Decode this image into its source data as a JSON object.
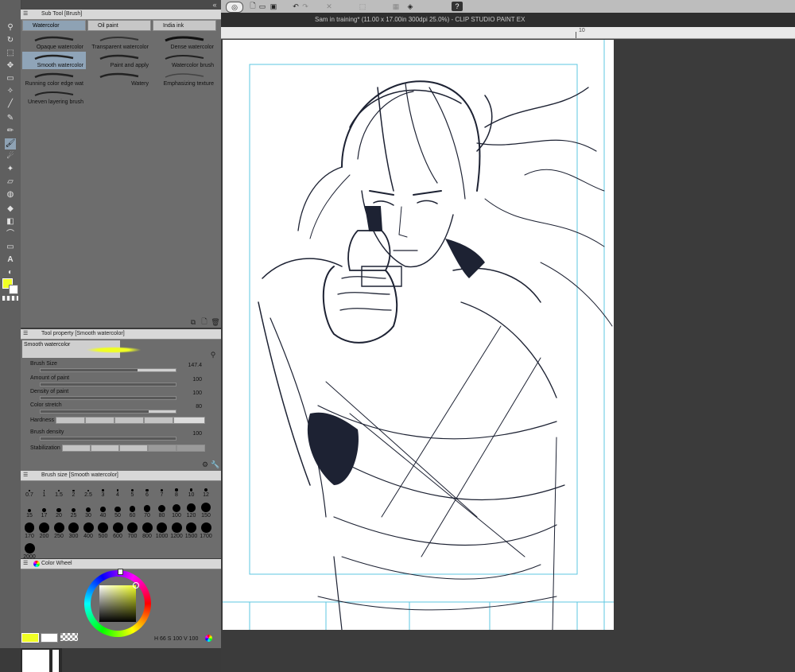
{
  "app": {
    "title": "Sam in training* (11.00 x 17.00in 300dpi 25.0%)  - CLIP STUDIO PAINT EX"
  },
  "ruler": {
    "mark": "10"
  },
  "subtool_panel": {
    "title": "Sub Tool [Brush]",
    "tabs": [
      {
        "label": "Watercolor",
        "active": true
      },
      {
        "label": "Oil paint",
        "active": false
      },
      {
        "label": "India ink",
        "active": false
      }
    ],
    "brushes": [
      {
        "label": "Opaque watercolor",
        "selected": false
      },
      {
        "label": "Transparent watercolor",
        "selected": false
      },
      {
        "label": "Dense watercolor",
        "selected": false
      },
      {
        "label": "Smooth watercolor",
        "selected": true
      },
      {
        "label": "Paint and apply",
        "selected": false
      },
      {
        "label": "Watercolor brush",
        "selected": false
      },
      {
        "label": "Running color edge wat",
        "selected": false
      },
      {
        "label": "Watery",
        "selected": false
      },
      {
        "label": "Emphasizing texture",
        "selected": false
      },
      {
        "label": "Uneven layering brush",
        "selected": false
      }
    ]
  },
  "tool_property": {
    "title": "Tool property [Smooth watercolor]",
    "tool_name": "Smooth watercolor",
    "props": [
      {
        "label": "Brush Size",
        "value": "147.4",
        "fraction": 0.72
      },
      {
        "label": "Amount of paint",
        "value": "100",
        "fraction": 1.0
      },
      {
        "label": "Density of paint",
        "value": "100",
        "fraction": 1.0
      },
      {
        "label": "Color stretch",
        "value": "80",
        "fraction": 0.8
      },
      {
        "label": "Brush density",
        "value": "100",
        "fraction": 1.0
      }
    ],
    "hardness_label": "Hardness",
    "stabilization_label": "Stabilization"
  },
  "brush_size_panel": {
    "title": "Brush size [Smooth watercolor]",
    "sizes": [
      "0.7",
      "1",
      "1.5",
      "2",
      "2.5",
      "3",
      "4",
      "5",
      "6",
      "7",
      "8",
      "10",
      "12",
      "15",
      "17",
      "20",
      "25",
      "30",
      "40",
      "50",
      "60",
      "70",
      "80",
      "100",
      "120",
      "150",
      "170",
      "200",
      "250",
      "300",
      "400",
      "500",
      "600",
      "700",
      "800",
      "1000",
      "1200",
      "1500",
      "1700",
      "2000"
    ]
  },
  "color_wheel_panel": {
    "title": "Color Wheel",
    "h": "66",
    "s": "100",
    "v": "100",
    "h_label": "H",
    "s_label": "S",
    "v_label": "V"
  },
  "colors": {
    "main": "#f0ff24",
    "sub": "#ffffff",
    "accent": "#8ea2b4"
  }
}
